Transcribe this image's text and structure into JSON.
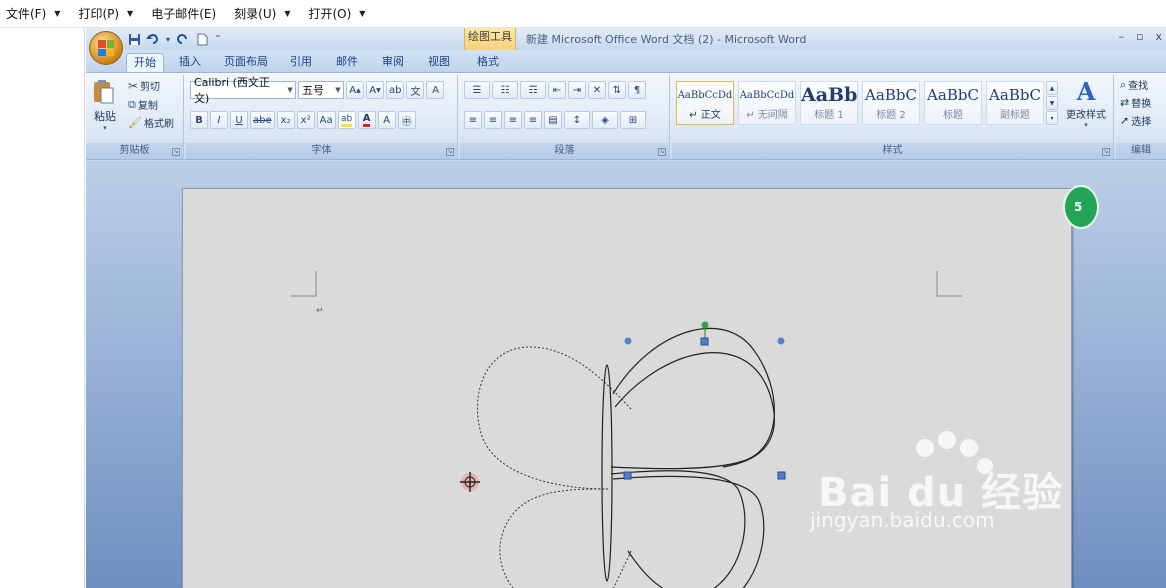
{
  "outer_menu": [
    {
      "label": "文件(F)",
      "has_caret": true
    },
    {
      "label": "打印(P)",
      "has_caret": true
    },
    {
      "label": "电子邮件(E)",
      "has_caret": false
    },
    {
      "label": "刻录(U)",
      "has_caret": true
    },
    {
      "label": "打开(O)",
      "has_caret": true
    }
  ],
  "caret_glyph": "▼",
  "word": {
    "contextual_group": "绘图工具",
    "title": "新建 Microsoft Office Word 文档 (2) - Microsoft Word",
    "window_controls": [
      "–",
      "▫",
      "x"
    ],
    "qat": [
      "save-icon",
      "undo-icon",
      "redo-icon",
      "new-icon"
    ],
    "tabs": [
      "开始",
      "插入",
      "页面布局",
      "引用",
      "邮件",
      "审阅",
      "视图",
      "格式"
    ],
    "active_tab": "开始",
    "clipboard": {
      "paste": "粘贴",
      "cut": "剪切",
      "copy": "复制",
      "format_painter": "格式刷",
      "label": "剪贴板"
    },
    "font": {
      "family": "Calibri (西文正文)",
      "size": "五号",
      "label": "字体",
      "buttons_row2": [
        "B",
        "I",
        "U",
        "abe",
        "x₂",
        "x²",
        "Aa"
      ]
    },
    "paragraph": {
      "label": "段落"
    },
    "styles": {
      "label": "样式",
      "items": [
        {
          "sample": "AaBbCcDd",
          "name": "↵ 正文"
        },
        {
          "sample": "AaBbCcDd",
          "name": "↵ 无间隔"
        },
        {
          "sample": "AaBb",
          "name": "标题 1"
        },
        {
          "sample": "AaBbC",
          "name": "标题 2"
        },
        {
          "sample": "AaBbC",
          "name": "标题"
        },
        {
          "sample": "AaBbC",
          "name": "副标题"
        }
      ],
      "change_styles": "更改样式"
    },
    "editing": {
      "label": "编辑",
      "find": "查找",
      "replace": "替换",
      "select": "选择"
    }
  },
  "side_badge": "5",
  "watermark": {
    "brand": "Bai du 经验",
    "url": "jingyan.baidu.com"
  }
}
